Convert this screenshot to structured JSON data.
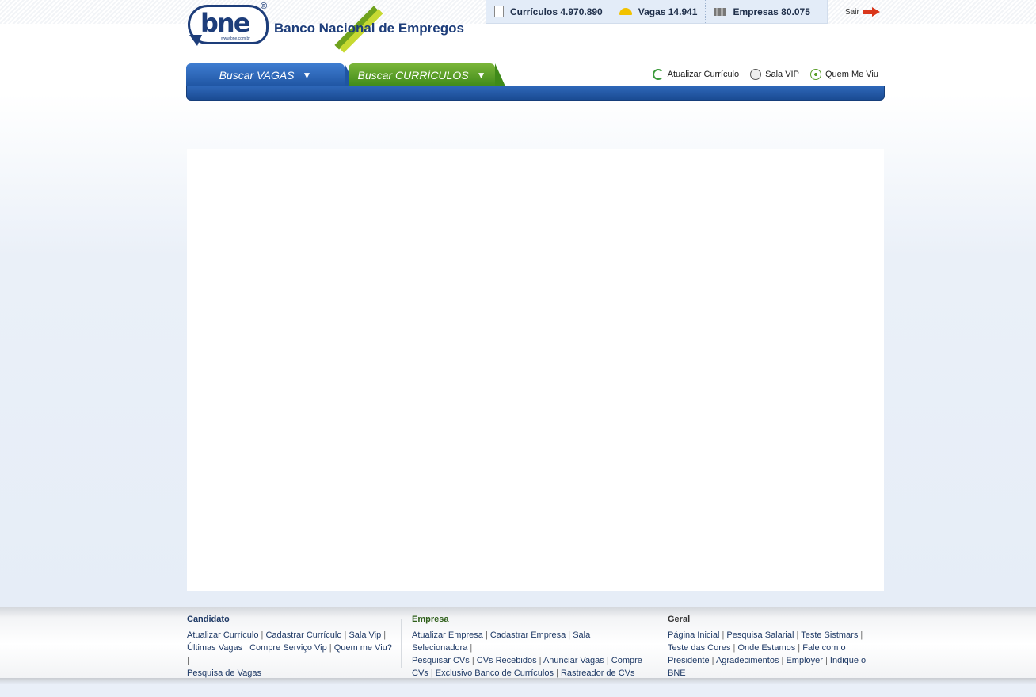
{
  "header": {
    "logo_text": "bne",
    "logo_url_text": "www.bne.com.br",
    "title": "Banco Nacional de Empregos",
    "stats": [
      {
        "label": "Currículos 4.970.890",
        "icon": "document-icon"
      },
      {
        "label": "Vagas 14.941",
        "icon": "helmet-icon"
      },
      {
        "label": "Empresas 80.075",
        "icon": "factory-icon"
      }
    ],
    "logout_label": "Sair"
  },
  "nav": {
    "tabs": [
      {
        "label": "Buscar VAGAS",
        "color": "#1f55a3"
      },
      {
        "label": "Buscar CURRÍCULOS",
        "color": "#3f8a19"
      }
    ],
    "quick_links": [
      {
        "label": "Atualizar Currículo",
        "icon": "refresh-icon"
      },
      {
        "label": "Sala VIP",
        "icon": "key-icon"
      },
      {
        "label": "Quem Me Viu",
        "icon": "target-icon"
      }
    ]
  },
  "footer": {
    "columns": [
      {
        "title": "Candidato",
        "links": [
          "Atualizar Currículo",
          "Cadastrar Currículo",
          "Sala Vip",
          "Últimas Vagas",
          "Compre Serviço Vip",
          "Quem me Viu?",
          "Pesquisa de Vagas"
        ]
      },
      {
        "title": "Empresa",
        "links": [
          "Atualizar Empresa",
          "Cadastrar Empresa",
          "Sala Selecionadora",
          "Pesquisar CVs",
          "CVs Recebidos",
          "Anunciar Vagas",
          "Compre CVs",
          "Exclusivo Banco de Currículos",
          "Rastreador de CVs"
        ]
      },
      {
        "title": "Geral",
        "links": [
          "Página Inicial",
          "Pesquisa Salarial",
          "Teste Sistmars",
          "Teste das Cores",
          "Onde Estamos",
          "Fale com o Presidente",
          "Agradecimentos",
          "Employer",
          "Indique o BNE"
        ]
      }
    ]
  }
}
